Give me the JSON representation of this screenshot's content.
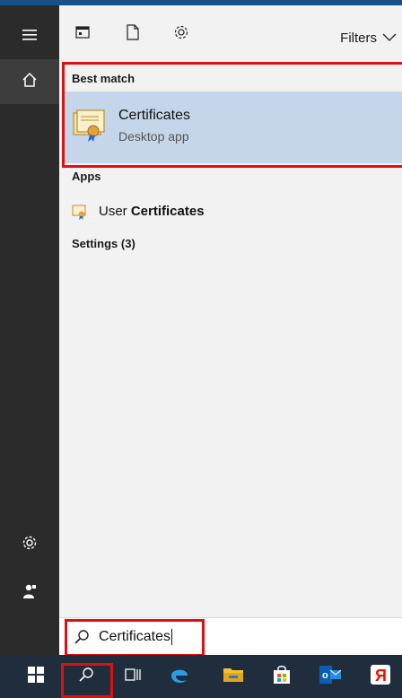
{
  "rail": {
    "items": [
      {
        "name": "hamburger-icon"
      },
      {
        "name": "home-icon"
      },
      {
        "name": "settings-gear-icon"
      },
      {
        "name": "user-icon"
      }
    ]
  },
  "toolbar": {
    "icons": [
      "apps-filter-icon",
      "documents-filter-icon",
      "settings-filter-icon"
    ],
    "filters_label": "Filters"
  },
  "results": {
    "best_match_heading": "Best match",
    "best_match": {
      "title": "Certificates",
      "subtitle": "Desktop app",
      "icon": "certificate-icon"
    },
    "apps_heading": "Apps",
    "apps": [
      {
        "prefix": "User ",
        "match": "Certificates",
        "icon": "user-certificate-icon"
      }
    ],
    "settings_heading": "Settings (3)"
  },
  "search": {
    "value": "Certificates",
    "icon": "search-icon"
  },
  "taskbar": {
    "items": [
      "windows-start-icon",
      "search-icon",
      "task-view-icon",
      "edge-icon",
      "file-explorer-icon",
      "store-icon",
      "outlook-icon",
      "yandex-icon"
    ]
  },
  "colors": {
    "highlight": "#c5d6ea",
    "annotation": "#e01010",
    "rail": "#2b2b2b",
    "taskbar": "#1f2d3d",
    "accent": "#1a4f8a"
  }
}
